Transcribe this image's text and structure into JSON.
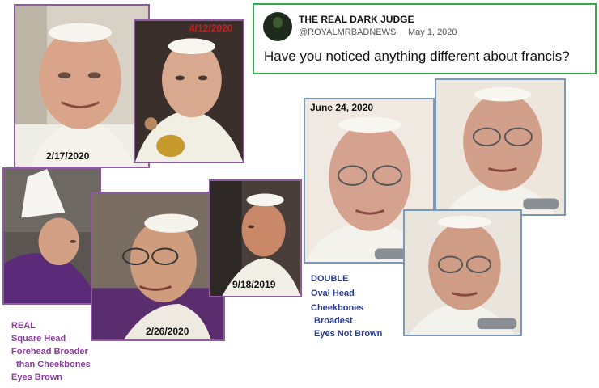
{
  "tweet": {
    "name": "THE REAL DARK JUDGE",
    "handle": "@ROYALMRBADNEWS",
    "date": "May 1, 2020",
    "text": "Have you noticed anything different about francis?"
  },
  "photos": {
    "p1": {
      "date": "2/17/2020"
    },
    "p2": {
      "date": "4/12/2020"
    },
    "p3": {
      "date": ""
    },
    "p4": {
      "date": "2/26/2020"
    },
    "p5": {
      "date": "9/18/2019"
    },
    "p6": {
      "date": "June 24, 2020"
    },
    "p7": {
      "date": ""
    },
    "p8": {
      "date": ""
    }
  },
  "real_caption": {
    "lines": [
      "REAL",
      "Square Head",
      "Forehead Broader",
      "than Cheekbones",
      "Eyes Brown"
    ]
  },
  "double_caption": {
    "lines": [
      "DOUBLE",
      "Oval Head",
      "Cheekbones",
      "Broadest",
      "Eyes Not Brown"
    ]
  },
  "colors": {
    "real_frame": "#8e5aa0",
    "double_frame": "#7d99b8",
    "tweet_border": "#3aa647",
    "real_text": "#8a3aa0",
    "double_text": "#263c8e",
    "date_red": "#c0231e"
  }
}
